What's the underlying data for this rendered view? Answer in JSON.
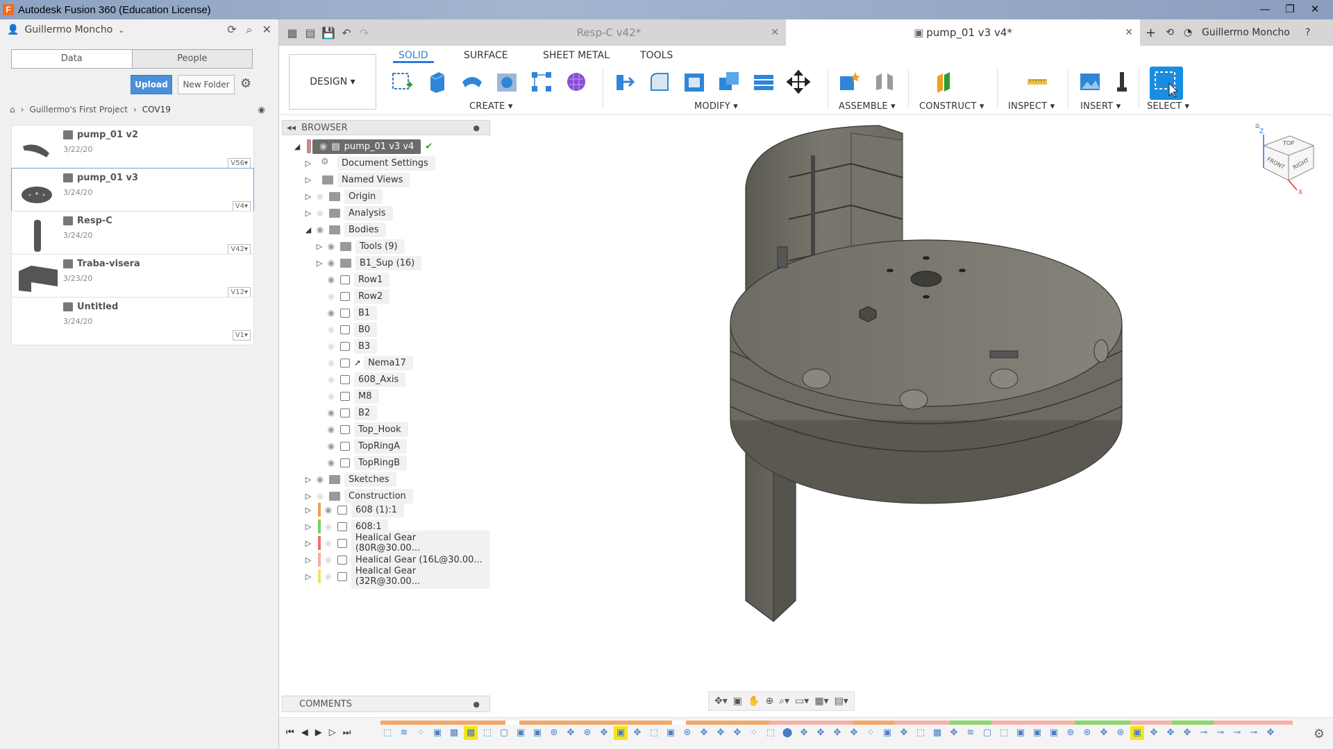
{
  "window": {
    "title": "Autodesk Fusion 360 (Education License)",
    "app_icon": "F"
  },
  "user": {
    "name": "Guillermo Moncho"
  },
  "data_panel": {
    "tabs": [
      "Data",
      "People"
    ],
    "upload_label": "Upload",
    "new_folder_label": "New Folder",
    "breadcrumb": [
      "Guillermo's First Project",
      "COV19"
    ],
    "files": [
      {
        "name": "pump_01 v2",
        "date": "3/22/20",
        "version": "V56"
      },
      {
        "name": "pump_01 v3",
        "date": "3/24/20",
        "version": "V4"
      },
      {
        "name": "Resp-C",
        "date": "3/24/20",
        "version": "V42"
      },
      {
        "name": "Traba-visera",
        "date": "3/23/20",
        "version": "V12"
      },
      {
        "name": "Untitled",
        "date": "3/24/20",
        "version": "V1"
      }
    ]
  },
  "doc_tabs": [
    {
      "label": "Resp-C v42*"
    },
    {
      "label": "pump_01 v3 v4*"
    }
  ],
  "toolbar": {
    "workspace": "DESIGN",
    "workspace_tabs": [
      "SOLID",
      "SURFACE",
      "SHEET METAL",
      "TOOLS"
    ],
    "groups": [
      "CREATE",
      "MODIFY",
      "ASSEMBLE",
      "CONSTRUCT",
      "INSPECT",
      "INSERT",
      "SELECT"
    ]
  },
  "browser": {
    "title": "BROWSER",
    "root": "pump_01 v3 v4",
    "items": [
      {
        "label": "Document Settings"
      },
      {
        "label": "Named Views"
      },
      {
        "label": "Origin"
      },
      {
        "label": "Analysis"
      },
      {
        "label": "Bodies"
      },
      {
        "label": "Tools (9)"
      },
      {
        "label": "B1_Sup (16)"
      },
      {
        "label": "Row1"
      },
      {
        "label": "Row2"
      },
      {
        "label": "B1"
      },
      {
        "label": "B0"
      },
      {
        "label": "B3"
      },
      {
        "label": "Nema17"
      },
      {
        "label": "608_Axis"
      },
      {
        "label": "M8"
      },
      {
        "label": "B2"
      },
      {
        "label": "Top_Hook"
      },
      {
        "label": "TopRingA"
      },
      {
        "label": "TopRingB"
      },
      {
        "label": "Sketches"
      },
      {
        "label": "Construction"
      },
      {
        "label": "608 (1):1"
      },
      {
        "label": "608:1"
      },
      {
        "label": "Healical Gear (80R@30.00..."
      },
      {
        "label": "Healical Gear (16L@30.00..."
      },
      {
        "label": "Healical Gear (32R@30.00..."
      }
    ]
  },
  "comments": {
    "title": "COMMENTS"
  },
  "colors": {
    "accent": "#2a7ed8",
    "upload": "#4a90d9",
    "select_tool": "#1a8de0"
  }
}
